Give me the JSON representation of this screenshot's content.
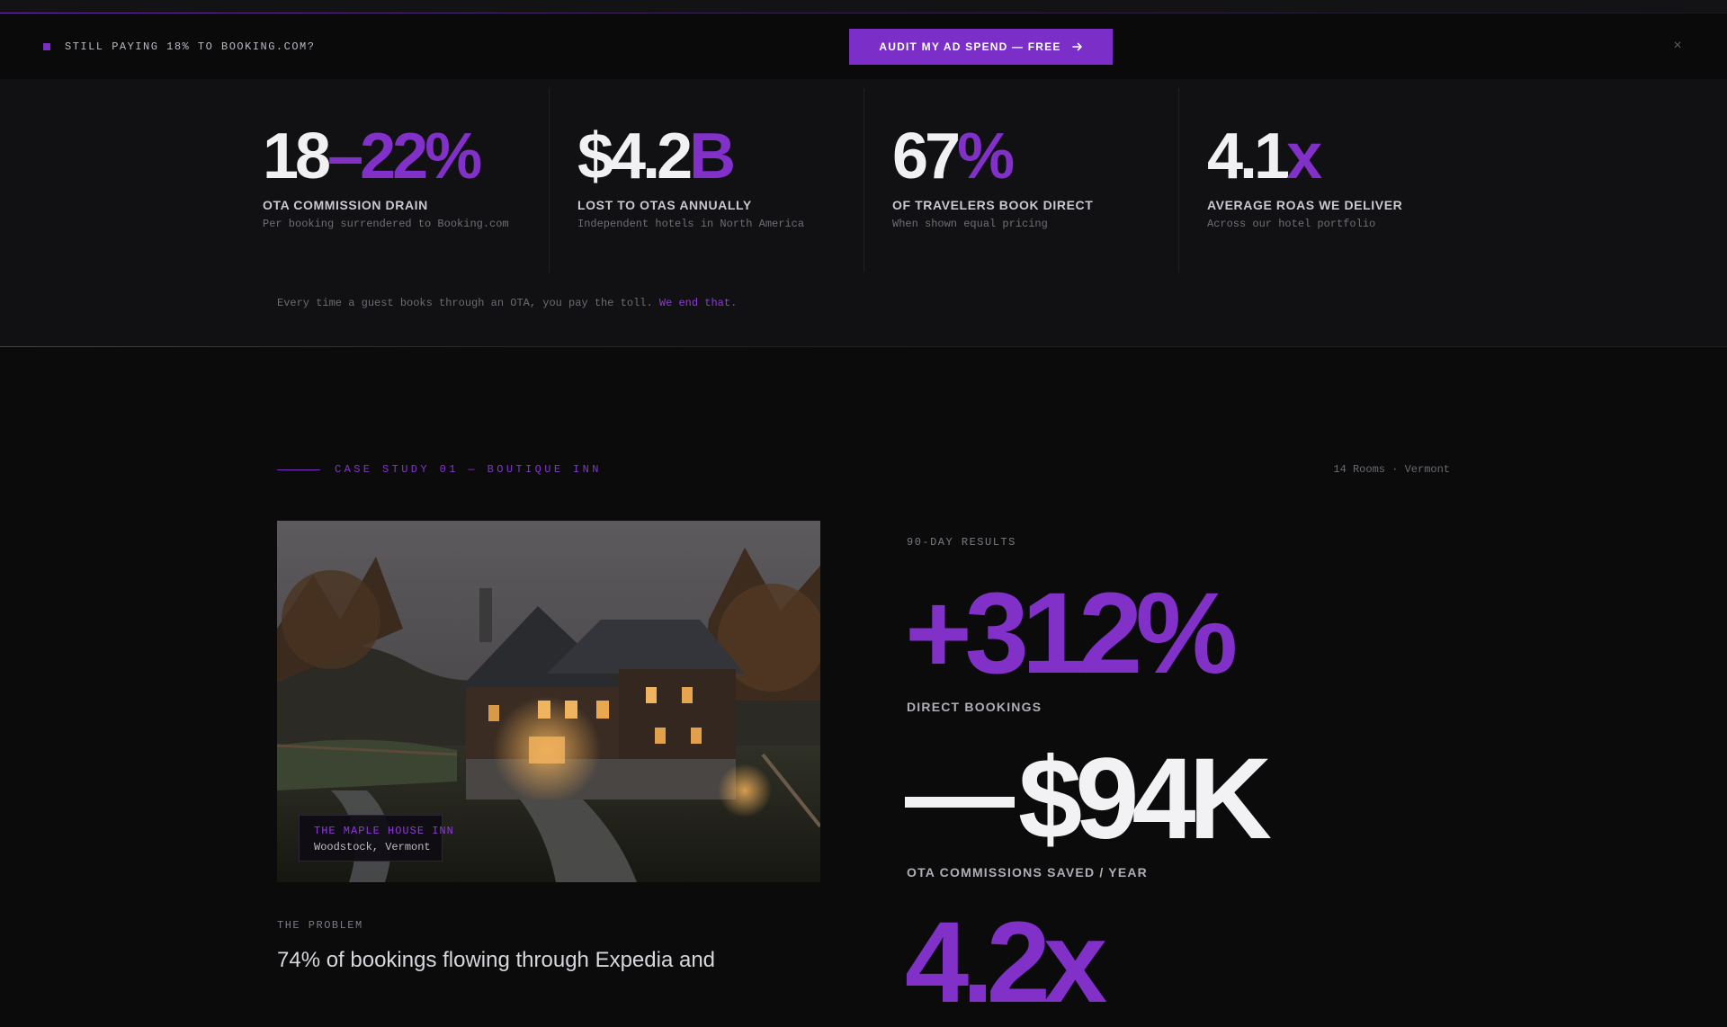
{
  "announcement": {
    "message": "STILL PAYING 18% TO BOOKING.COM?",
    "cta_label": "AUDIT MY AD SPEND — FREE",
    "cta_icon": "arrow-right-icon",
    "close_icon": "close-icon",
    "close_glyph": "×",
    "accent": "#7b2ec8"
  },
  "stats": [
    {
      "value_main": "18",
      "value_accent": "–22%",
      "label": "OTA COMMISSION DRAIN",
      "sub": "Per booking surrendered to Booking.com"
    },
    {
      "value_main": "$4.2",
      "value_accent": "B",
      "label": "LOST TO OTAS ANNUALLY",
      "sub": "Independent hotels in North America"
    },
    {
      "value_main": "67",
      "value_accent": "%",
      "label": "OF TRAVELERS BOOK DIRECT",
      "sub": "When shown equal pricing"
    },
    {
      "value_main": "4.1",
      "value_accent": "x",
      "label": "AVERAGE ROAS WE DELIVER",
      "sub": "Across our hotel portfolio"
    }
  ],
  "stats_note": {
    "text": "Every time a guest books through an OTA, you pay the toll.",
    "highlight": "We end that."
  },
  "case_study": {
    "eyebrow": "CASE STUDY 01 — BOUTIQUE INN",
    "meta": "14 Rooms · Vermont",
    "property_name": "THE MAPLE HOUSE INN",
    "property_location": "Woodstock, Vermont",
    "problem_label": "THE PROBLEM",
    "problem_text": "74% of bookings flowing through Expedia and",
    "results_label": "90-DAY RESULTS",
    "result_1_value": "+312%",
    "result_1_label": "DIRECT BOOKINGS",
    "result_2_value": "$94K",
    "result_2_label": "OTA COMMISSIONS SAVED / YEAR",
    "result_3_value": "4.2x"
  }
}
